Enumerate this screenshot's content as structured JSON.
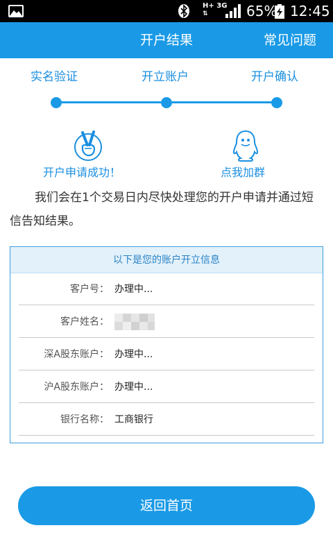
{
  "status_bar": {
    "network_type": "H+",
    "network_gen": "3G",
    "battery_percent": "65%",
    "time": "12:45"
  },
  "header": {
    "title": "开户结果",
    "faq_label": "常见问题"
  },
  "steps": [
    {
      "label": "实名验证"
    },
    {
      "label": "开立账户"
    },
    {
      "label": "开户确认"
    }
  ],
  "result": {
    "success_text": "开户申请成功！",
    "join_group_text": "点我加群",
    "notice": "我们会在1个交易日内尽快处理您的开户申请并通过短信告知结果。"
  },
  "account_info": {
    "header": "以下是您的账户开立信息",
    "rows": [
      {
        "label": "客户号：",
        "value": "办理中..."
      },
      {
        "label": "客户姓名：",
        "value": ""
      },
      {
        "label": "深A股东账户：",
        "value": "办理中..."
      },
      {
        "label": "沪A股东账户：",
        "value": "办理中..."
      },
      {
        "label": "银行名称：",
        "value": "工商银行"
      }
    ]
  },
  "back_button_label": "返回首页",
  "colors": {
    "accent": "#1a9ae6",
    "accent_text": "#1a8fe0",
    "panel_header_bg": "#e3f1fb"
  }
}
